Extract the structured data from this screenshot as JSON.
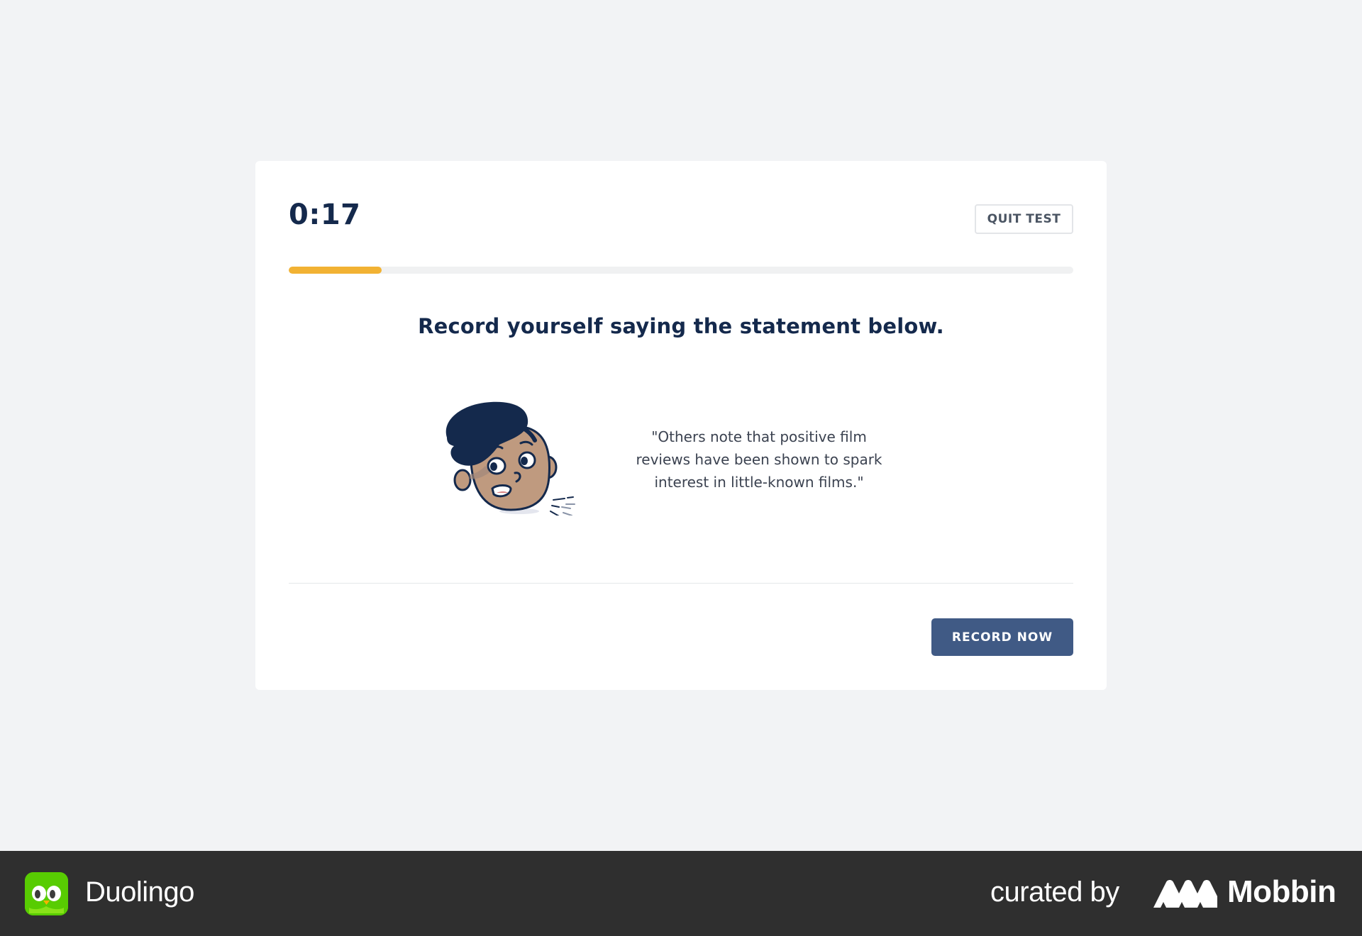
{
  "test": {
    "timer": "0:17",
    "quit_label": "QUIT TEST",
    "progress_fraction": 0.118
  },
  "question": {
    "prompt": "Record yourself saying the statement below.",
    "statement": "\"Others note that positive film reviews have been shown to spark interest in little-known films.\"",
    "avatar_icon": "speaking-character-icon"
  },
  "actions": {
    "record_label": "RECORD NOW"
  },
  "footer": {
    "brand_name": "Duolingo",
    "brand_icon": "duolingo-owl-icon",
    "curated_label": "curated by",
    "curator_name": "Mobbin",
    "curator_icon": "mobbin-logo-icon"
  },
  "colors": {
    "background": "#f2f3f5",
    "card": "#ffffff",
    "navy_text": "#14294c",
    "progress_fill": "#f2b233",
    "primary_button": "#405a85",
    "footer": "#2f2f2f",
    "duolingo_green": "#58cc02"
  }
}
